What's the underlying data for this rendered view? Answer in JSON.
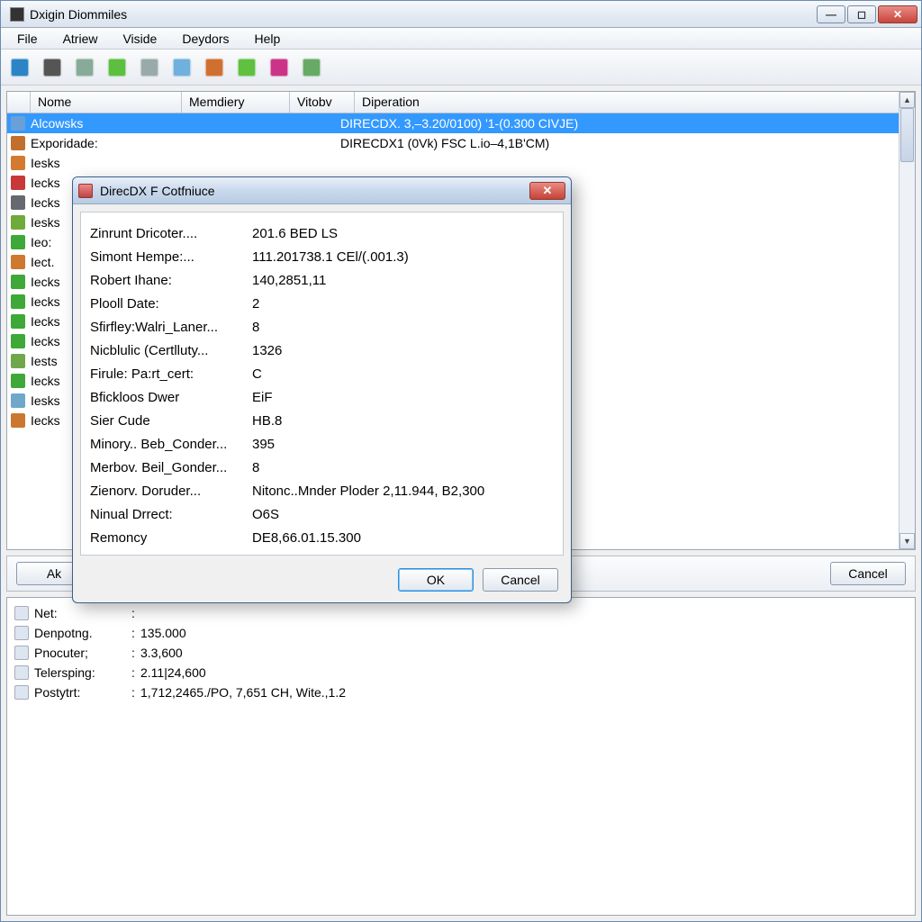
{
  "window": {
    "title": "Dxigin Diommiles"
  },
  "menu": {
    "items": [
      "File",
      "Atriew",
      "Viside",
      "Deydors",
      "Help"
    ]
  },
  "toolbar_icons": [
    {
      "name": "globe-icon",
      "bg": "#2a84c5"
    },
    {
      "name": "music-icon",
      "bg": "#555"
    },
    {
      "name": "doc-icon",
      "bg": "#8a9"
    },
    {
      "name": "ball-green-icon",
      "bg": "#5cbf3f"
    },
    {
      "name": "list-icon",
      "bg": "#9aa"
    },
    {
      "name": "page-icon",
      "bg": "#6fb0dd"
    },
    {
      "name": "people-icon",
      "bg": "#d07030"
    },
    {
      "name": "plus-green-icon",
      "bg": "#60c040"
    },
    {
      "name": "wrench-icon",
      "bg": "#c38"
    },
    {
      "name": "refresh-icon",
      "bg": "#6a6"
    }
  ],
  "list": {
    "columns": {
      "nome": "Nome",
      "memdiery": "Memdiery",
      "vitobv": "Vitobv",
      "diperation": "Diperation"
    },
    "col_widths": {
      "nome": 168,
      "memdiery": 120,
      "vitobv": 72
    },
    "rows": [
      {
        "icon": "#6aa0d8",
        "nome": "Alcowsks",
        "mem": "",
        "vit": "",
        "dip": "DIRECDX. 3,–3.20/0100) '1-(0.300 CIVJE)",
        "selected": true
      },
      {
        "icon": "#c0702a",
        "nome": "Exporidade:",
        "mem": "",
        "vit": "",
        "dip": "DIRECDX1 (0Vk) FSC L.io–4,1B'CM)"
      },
      {
        "icon": "#d47a30",
        "nome": "Iesks"
      },
      {
        "icon": "#c83838",
        "nome": "Iecks"
      },
      {
        "icon": "#666a70",
        "nome": "Iecks"
      },
      {
        "icon": "#6faa3a",
        "nome": "Iesks"
      },
      {
        "icon": "#3ea838",
        "nome": "Ieo:"
      },
      {
        "icon": "#ce7830",
        "nome": "Iect."
      },
      {
        "icon": "#3ea838",
        "nome": "Iecks"
      },
      {
        "icon": "#3ea838",
        "nome": "Iecks"
      },
      {
        "icon": "#3ea838",
        "nome": "Iecks"
      },
      {
        "icon": "#3ea838",
        "nome": "Iecks"
      },
      {
        "icon": "#6fa84a",
        "nome": "Iests"
      },
      {
        "icon": "#3ea838",
        "nome": "Iecks"
      },
      {
        "icon": "#6fa8c8",
        "nome": "Iesks"
      },
      {
        "icon": "#cc7730",
        "nome": "Iecks"
      }
    ]
  },
  "bottom_buttons": {
    "left": "Ak",
    "cancel": "Cancel"
  },
  "info_panel": {
    "lines": [
      {
        "label": "Net:",
        "value": ""
      },
      {
        "label": "Denpotng.",
        "value": "135.000"
      },
      {
        "label": "Pnocuter;",
        "value": "3.3,600"
      },
      {
        "label": "Telersping:",
        "value": "2.11|24,600"
      },
      {
        "label": "Postytrt:",
        "value": "1,712,2465./PO, 7,651 CH, Wite.,1.2"
      }
    ]
  },
  "dialog": {
    "title": "DirecDX F Cotfniuce",
    "properties": [
      {
        "label": "Zinrunt Dricoter....",
        "value": "201.6 BED LS"
      },
      {
        "label": "Simont Hempe:...",
        "value": "111.201738.1 CEl/(.001.3)"
      },
      {
        "label": "Robert Ihane:",
        "value": "140,2851,11"
      },
      {
        "label": "Plooll Date:",
        "value": "2"
      },
      {
        "label": "Sfirfley:Walri_Laner...",
        "value": "8"
      },
      {
        "label": "Nicblulic (Certlluty...",
        "value": "1326"
      },
      {
        "label": "Firule: Pa:rt_cert:",
        "value": "C"
      },
      {
        "label": "Bfickloos Dwer",
        "value": "EiF"
      },
      {
        "label": "Sier Cude",
        "value": "HB.8"
      },
      {
        "label": "Minory.. Beb_Conder...",
        "value": "395"
      },
      {
        "label": "Merbov. Beil_Gonder...",
        "value": "8"
      },
      {
        "label": "Zienorv. Doruder...",
        "value": "Nitonc..Mnder Ploder 2,11.944, B2,300"
      },
      {
        "label": "Ninual Drrect:",
        "value": "O6S"
      },
      {
        "label": "Remoncy",
        "value": "DE8,66.01.15.300"
      }
    ],
    "ok": "OK",
    "cancel": "Cancel"
  }
}
